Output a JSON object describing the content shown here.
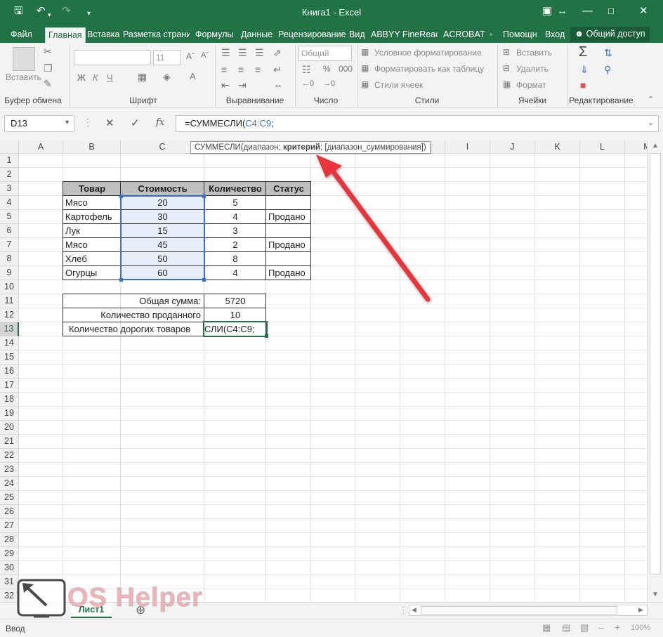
{
  "window": {
    "title": "Книга1 - Excel"
  },
  "ribbon": {
    "tabs": [
      "Файл",
      "Главная",
      "Вставка",
      "Разметка страни",
      "Формулы",
      "Данные",
      "Рецензирование",
      "Вид",
      "ABBYY FineReade",
      "ACROBAT",
      "Помощн",
      "Вход"
    ],
    "share_label": "Общий доступ",
    "clipboard": {
      "paste_label": "Вставить",
      "group_label": "Буфер обмена"
    },
    "font": {
      "font_size": "11",
      "bold": "Ж",
      "italic": "К",
      "underline": "Ч",
      "group_label": "Шрифт"
    },
    "alignment": {
      "group_label": "Выравнивание"
    },
    "number": {
      "format": "Общий",
      "group_label": "Число"
    },
    "styles": {
      "conditional": "Условное форматирование",
      "format_table": "Форматировать как таблицу",
      "cell_styles": "Стили ячеек",
      "group_label": "Стили"
    },
    "cells": {
      "insert": "Вставить",
      "delete": "Удалить",
      "format": "Формат",
      "group_label": "Ячейки"
    },
    "editing": {
      "group_label": "Редактирование"
    }
  },
  "formula_bar": {
    "name_box": "D13",
    "fx": "fx",
    "formula_prefix": "=СУММЕСЛИ(",
    "formula_ref": "C4:C9",
    "formula_suffix": ";"
  },
  "tooltip": {
    "prefix": "СУММЕСЛИ(диапазон; ",
    "bold": "критерий",
    "suffix": "; [диапазон_суммирования])"
  },
  "columns": [
    "A",
    "B",
    "C",
    "D",
    "E",
    "F",
    "G",
    "H",
    "I",
    "J",
    "K",
    "L",
    "M"
  ],
  "rows": [
    "1",
    "2",
    "3",
    "4",
    "5",
    "6",
    "7",
    "8",
    "9",
    "10",
    "11",
    "12",
    "13",
    "14",
    "15",
    "16",
    "17",
    "18",
    "19",
    "20",
    "21",
    "22",
    "23",
    "24",
    "25",
    "26",
    "27",
    "28",
    "29",
    "30",
    "31",
    "32"
  ],
  "table": {
    "headers": [
      "Товар",
      "Стоимость",
      "Количество",
      "Статус"
    ],
    "rows": [
      [
        "Мясо",
        "20",
        "5",
        ""
      ],
      [
        "Картофель",
        "30",
        "4",
        "Продано"
      ],
      [
        "Лук",
        "15",
        "3",
        ""
      ],
      [
        "Мясо",
        "45",
        "2",
        "Продано"
      ],
      [
        "Хлеб",
        "50",
        "8",
        ""
      ],
      [
        "Огурцы",
        "60",
        "4",
        "Продано"
      ]
    ]
  },
  "summary": [
    {
      "label": "Общая сумма:",
      "value": "5720"
    },
    {
      "label": "Количество проданного",
      "value": "10"
    },
    {
      "label": "Количество дорогих товаров",
      "value": "СЛИ(C4:C9;"
    }
  ],
  "sheet": {
    "tab": "Лист1"
  },
  "status": {
    "mode": "Ввод",
    "zoom": "100%"
  },
  "watermark": {
    "text": "OS Helper"
  },
  "colors": {
    "excel_green": "#217346",
    "arrow": "#e8353a",
    "selection": "#3b6fc7"
  }
}
